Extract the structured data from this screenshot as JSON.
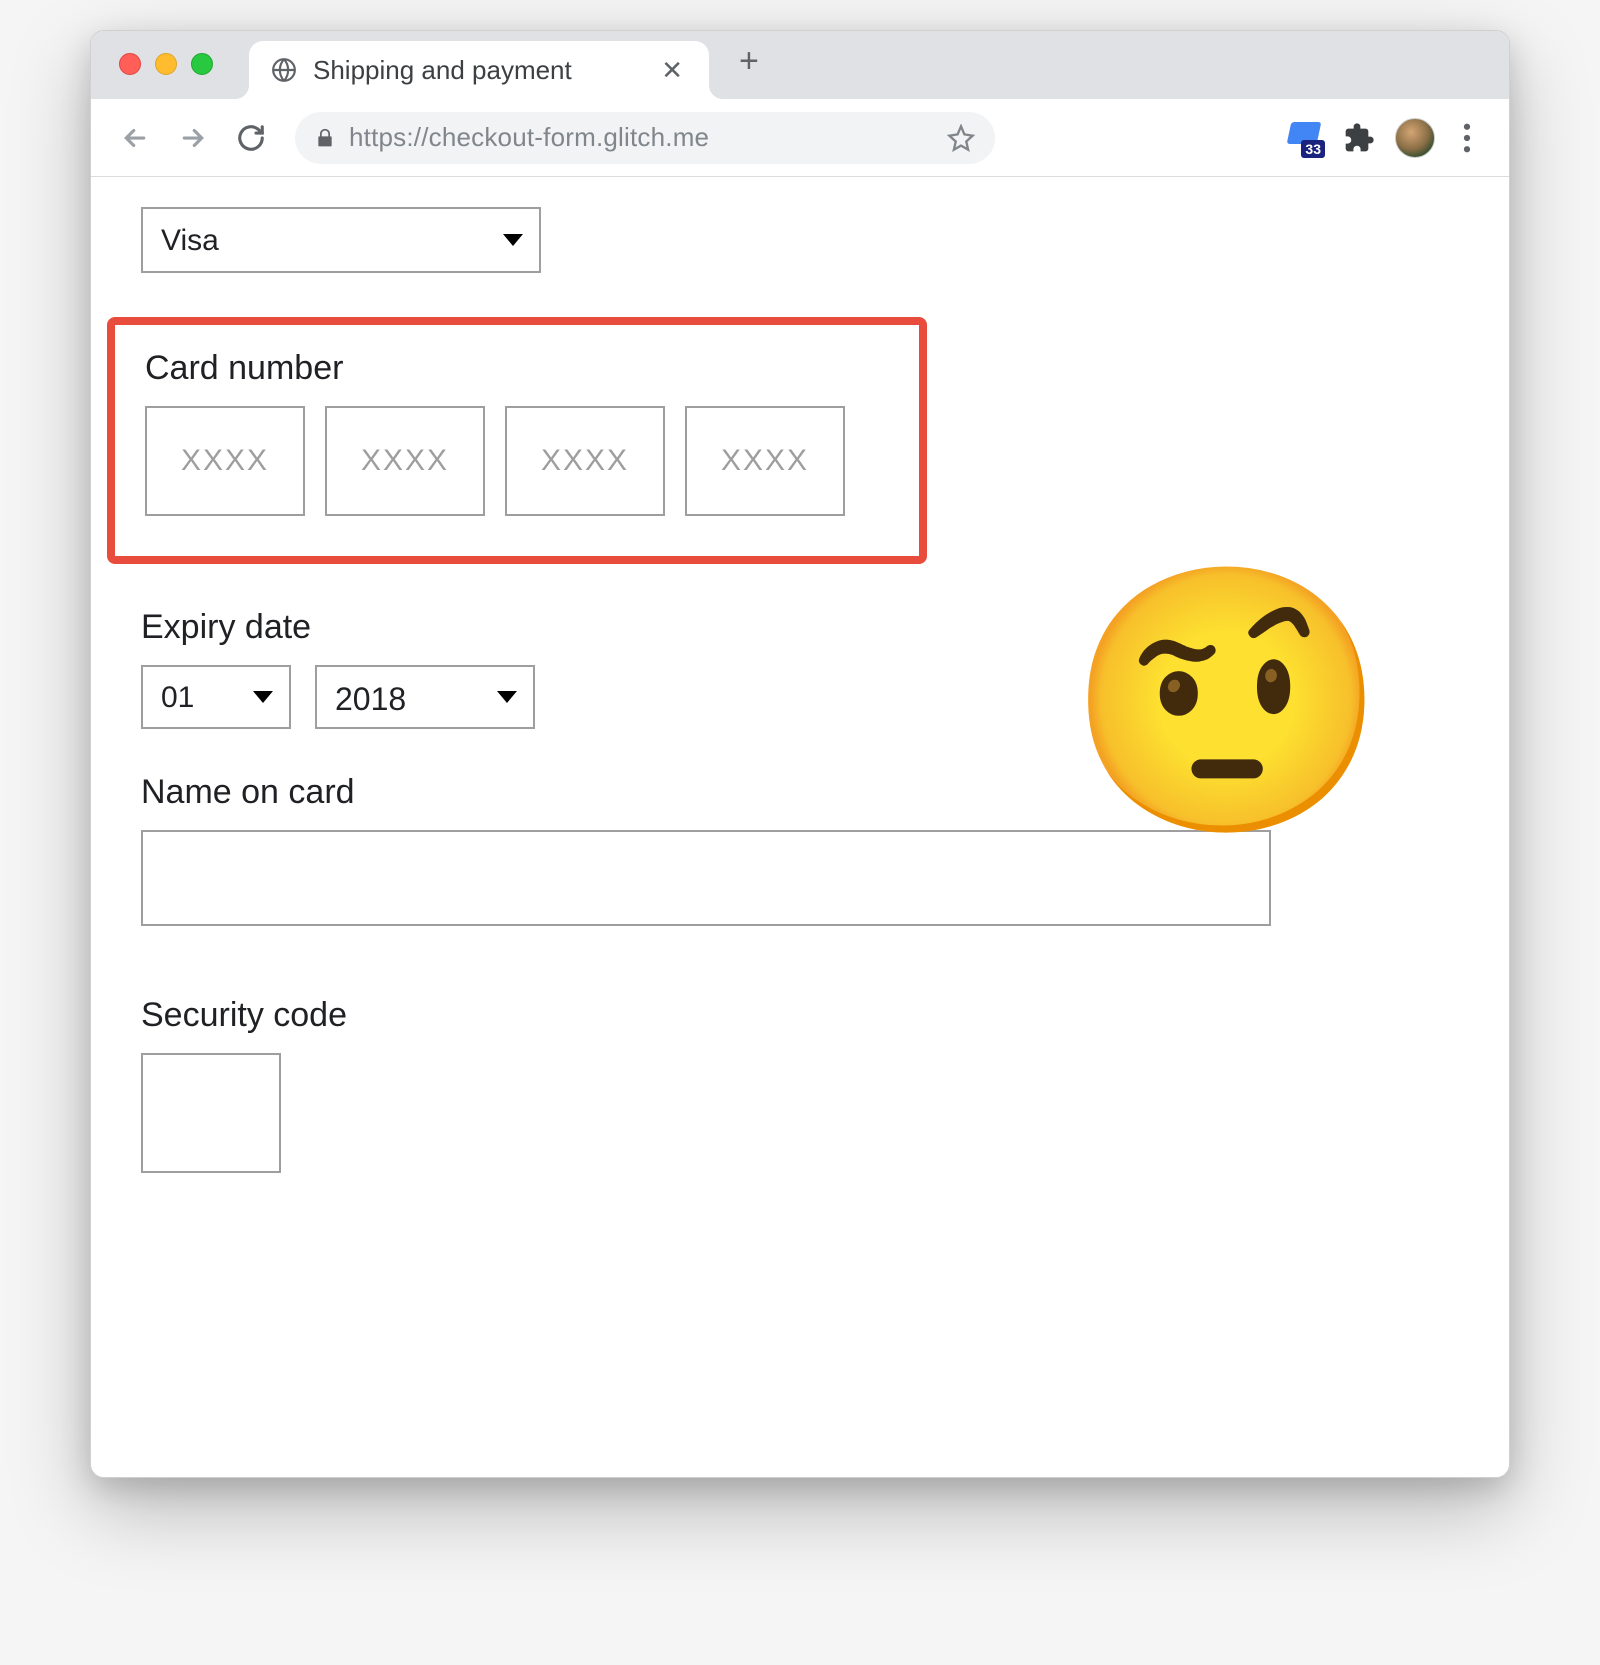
{
  "browser": {
    "tab_title": "Shipping and payment",
    "url": "https://checkout-form.glitch.me",
    "extension_badge": "33"
  },
  "form": {
    "card_type": {
      "value": "Visa"
    },
    "card_number": {
      "label": "Card number",
      "placeholders": [
        "XXXX",
        "XXXX",
        "XXXX",
        "XXXX"
      ]
    },
    "expiry": {
      "label": "Expiry date",
      "month": "01",
      "year": "2018"
    },
    "name_on_card": {
      "label": "Name on card",
      "value": ""
    },
    "security_code": {
      "label": "Security code",
      "value": ""
    }
  },
  "annotation": {
    "emoji": "🤨"
  }
}
